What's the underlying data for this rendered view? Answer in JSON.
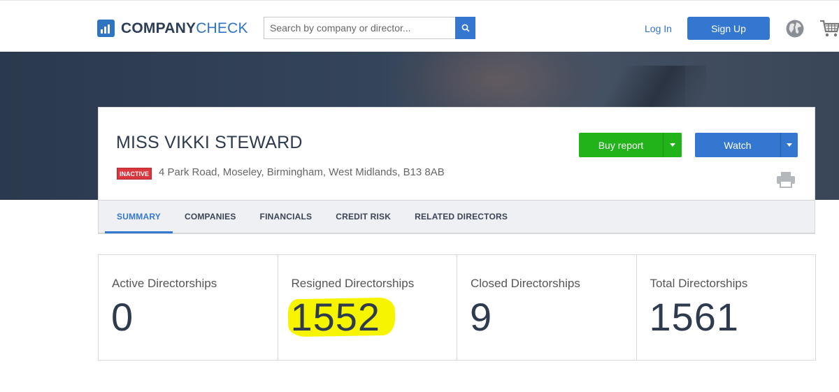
{
  "header": {
    "logo_part1": "COMPANY",
    "logo_part2": "CHECK",
    "search_placeholder": "Search by company or director...",
    "login_label": "Log In",
    "signup_label": "Sign Up",
    "icons": [
      "chart-bars-icon",
      "search-icon",
      "globe-icon",
      "cart-icon"
    ]
  },
  "profile": {
    "name": "MISS VIKKI STEWARD",
    "status_badge": "INACTIVE",
    "address": "4 Park Road, Moseley, Birmingham, West Midlands, B13 8AB",
    "buy_report_label": "Buy report",
    "watch_label": "Watch"
  },
  "tabs": [
    {
      "label": "SUMMARY",
      "active": true
    },
    {
      "label": "COMPANIES",
      "active": false
    },
    {
      "label": "FINANCIALS",
      "active": false
    },
    {
      "label": "CREDIT RISK",
      "active": false
    },
    {
      "label": "RELATED DIRECTORS",
      "active": false
    }
  ],
  "stats": [
    {
      "label": "Active Directorships",
      "value": "0"
    },
    {
      "label": "Resigned Directorships",
      "value": "1552",
      "highlighted": true
    },
    {
      "label": "Closed Directorships",
      "value": "9"
    },
    {
      "label": "Total Directorships",
      "value": "1561"
    }
  ],
  "colors": {
    "brand_blue": "#3477d0",
    "buy_green": "#22b21a",
    "inactive_red": "#d9363e",
    "highlight_yellow": "#f7f400",
    "hero_dark": "#2b394e"
  }
}
